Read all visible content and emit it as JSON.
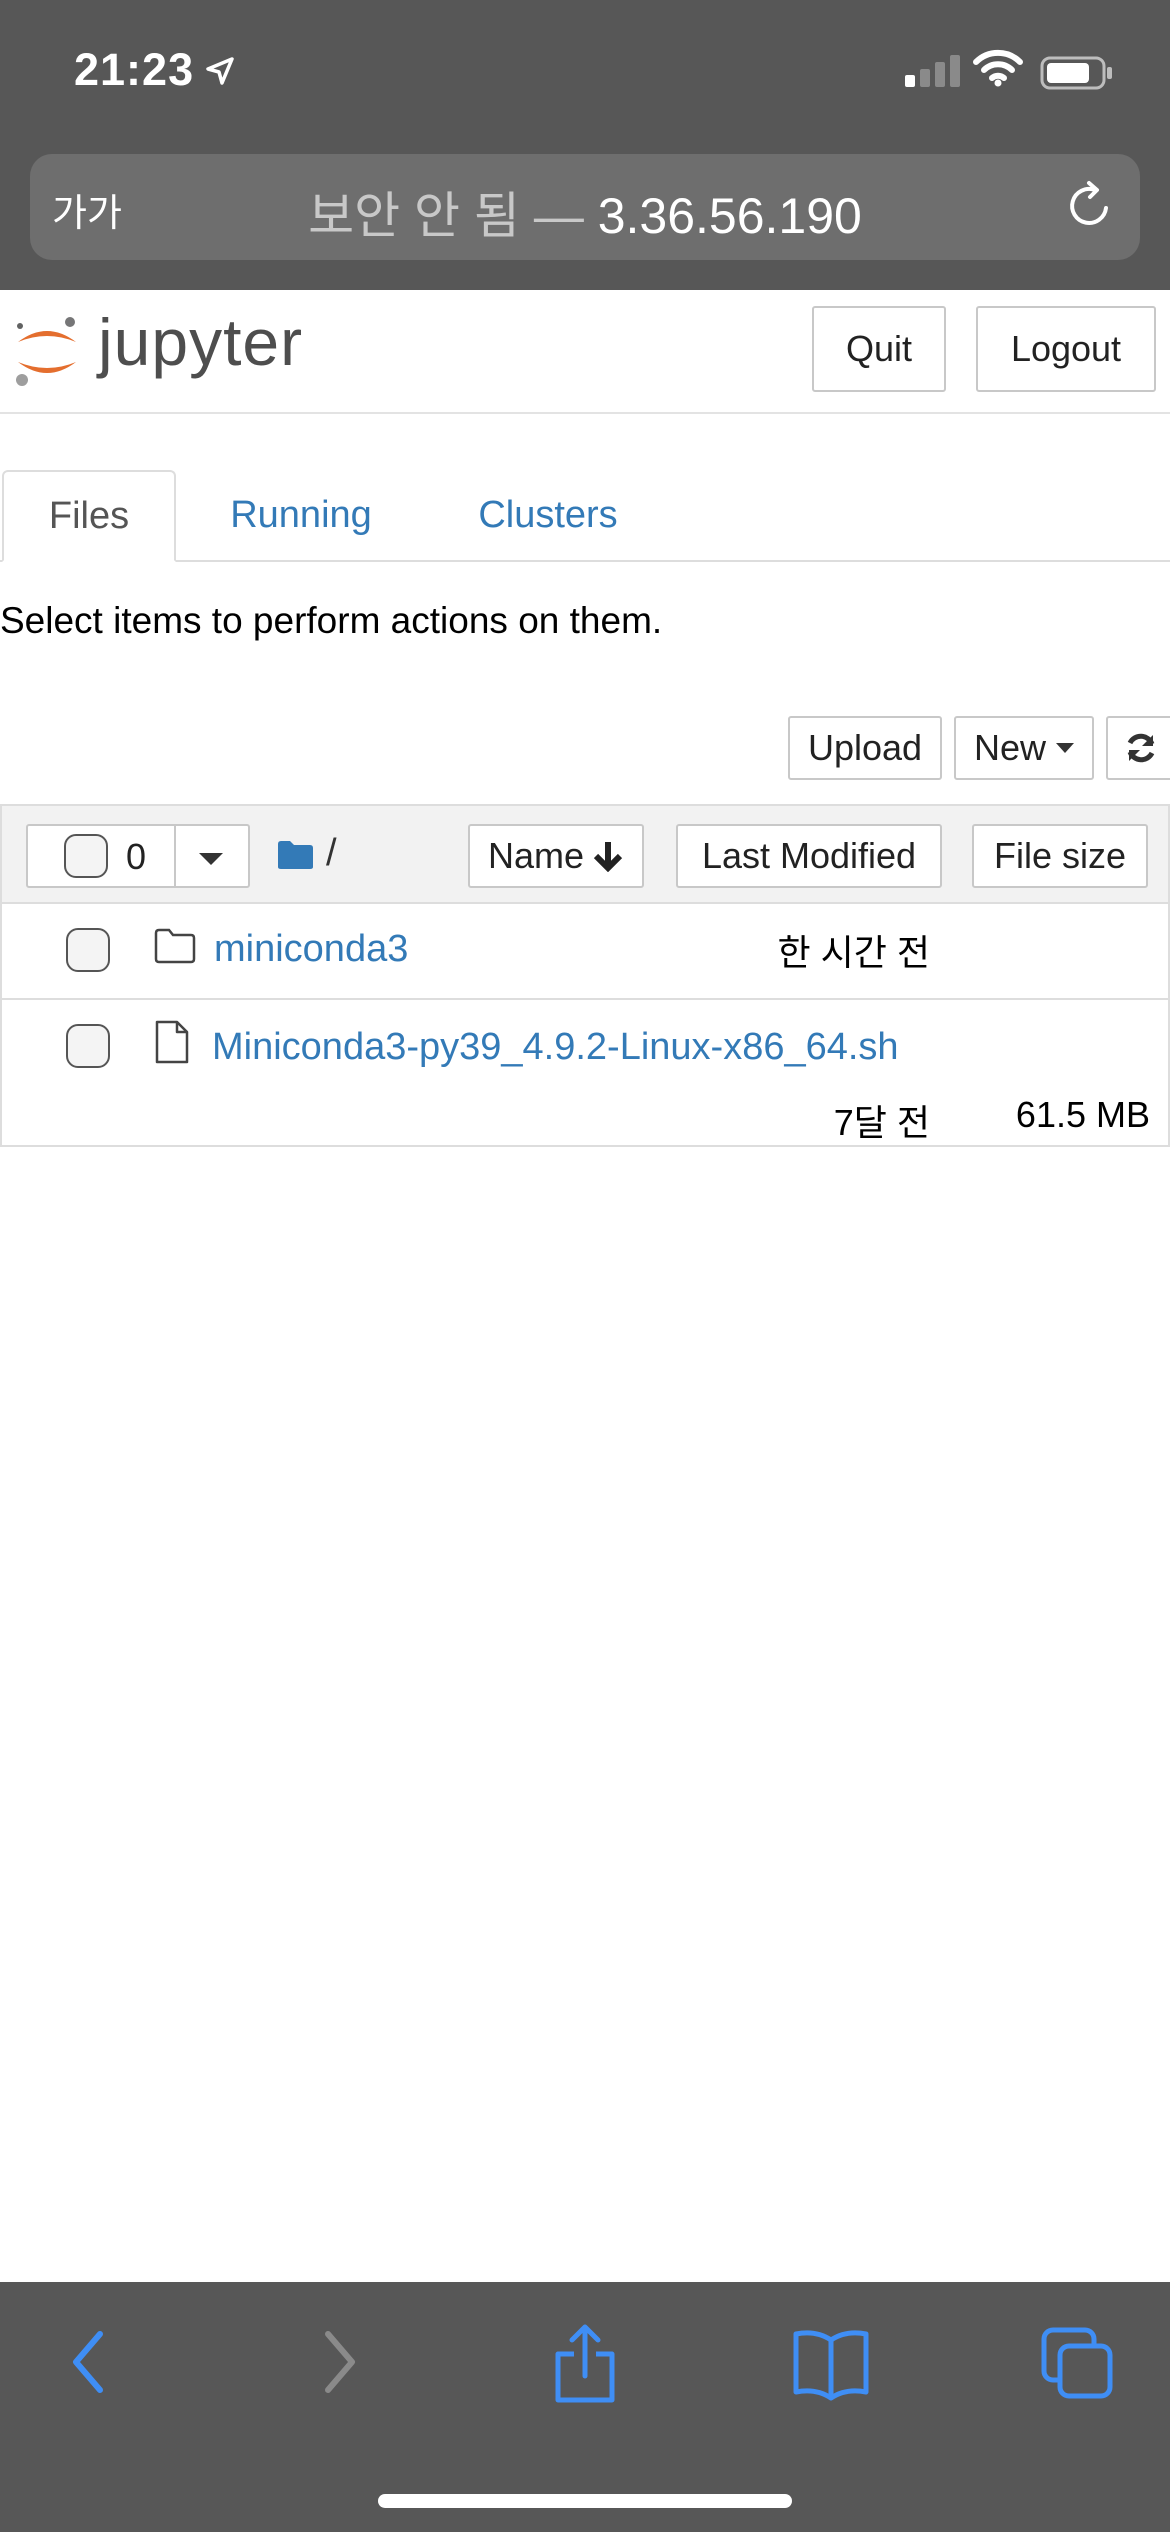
{
  "status_bar": {
    "time": "21:23",
    "icons": [
      "location-arrow-icon",
      "cell-signal-icon",
      "wifi-icon",
      "battery-icon"
    ]
  },
  "safari": {
    "text_size_button": "가가",
    "url_insecure_label": "보안 안 됨",
    "url_separator": " — ",
    "url_host": "3.36.56.190",
    "reload_icon": "reload-icon"
  },
  "jupyter": {
    "logo_text": "jupyter",
    "quit_label": "Quit",
    "logout_label": "Logout",
    "tabs": [
      {
        "label": "Files",
        "active": true
      },
      {
        "label": "Running",
        "active": false
      },
      {
        "label": "Clusters",
        "active": false
      }
    ],
    "hint": "Select items to perform actions on them.",
    "toolbar": {
      "upload_label": "Upload",
      "new_label": "New",
      "refresh_icon": "refresh-icon"
    },
    "list_header": {
      "selected_count": "0",
      "path": "/",
      "sort_name_label": "Name",
      "sort_modified_label": "Last Modified",
      "sort_size_label": "File size"
    },
    "items": [
      {
        "type": "folder",
        "name": "miniconda3",
        "modified": "한 시간 전",
        "size": ""
      },
      {
        "type": "file",
        "name": "Miniconda3-py39_4.9.2-Linux-x86_64.sh",
        "modified": "7달 전",
        "size": "61.5 MB"
      }
    ]
  },
  "colors": {
    "chrome_gray": "#575757",
    "link_blue": "#337ab7",
    "safari_blue": "#3f8ef5"
  }
}
